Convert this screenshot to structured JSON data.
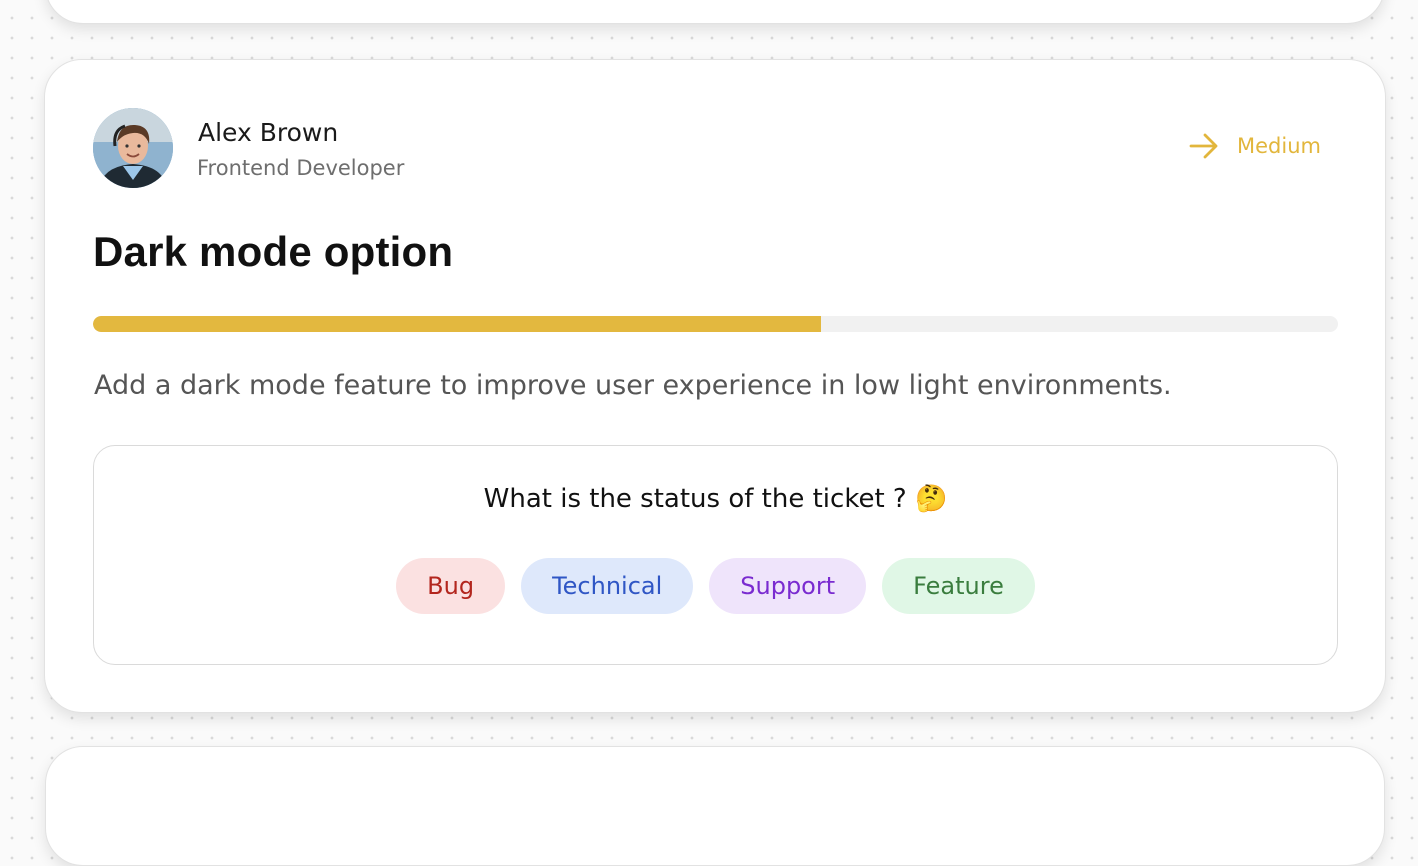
{
  "ticket": {
    "author": {
      "name": "Alex Brown",
      "role": "Frontend Developer",
      "avatar_icon": "user-photo"
    },
    "priority": {
      "icon": "arrow-right-icon",
      "label": "Medium",
      "color": "#e2b63c"
    },
    "title": "Dark mode option",
    "progress": 0.585,
    "progress_color": "#e3b83f",
    "description": "Add a dark mode feature to improve user experience in low light environments.",
    "status_prompt": {
      "question": "What is the status of the ticket ? 🤔",
      "options": [
        {
          "label": "Bug",
          "bg": "#fbe1e1",
          "color": "#b3261e"
        },
        {
          "label": "Technical",
          "bg": "#dee8fb",
          "color": "#2f56c5"
        },
        {
          "label": "Support",
          "bg": "#efe4fb",
          "color": "#7a2bd0"
        },
        {
          "label": "Feature",
          "bg": "#e0f7e6",
          "color": "#3a7d3e"
        }
      ]
    }
  }
}
